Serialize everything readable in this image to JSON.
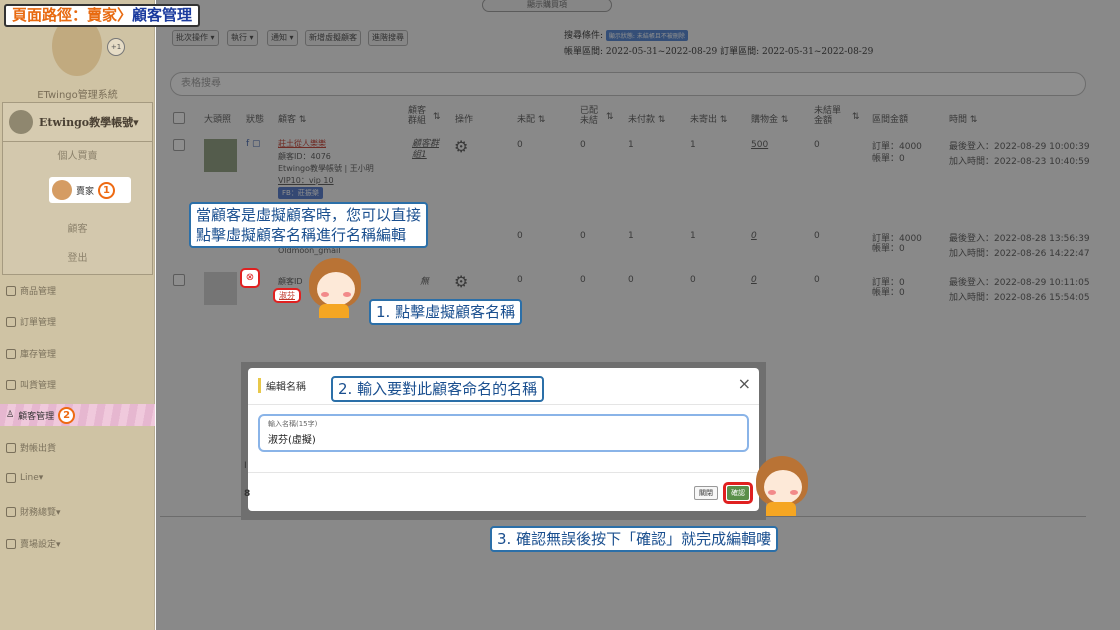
{
  "breadcrumb": {
    "prefix": "頁面路徑：賣家",
    "separator": "〉",
    "current": "顧客管理"
  },
  "sidebar": {
    "system_name": "ETwingo管理系統",
    "badge": "+1",
    "account": "Etwingo教學帳號▾",
    "menu": {
      "personal": "個人買賣",
      "seller": "賣家",
      "seller_step": "1",
      "customer": "顧客",
      "logout": "登出"
    },
    "items": [
      {
        "label": "商品管理"
      },
      {
        "label": "訂單管理"
      },
      {
        "label": "庫存管理"
      },
      {
        "label": "叫貨管理"
      },
      {
        "label": "顧客管理",
        "step": "2"
      },
      {
        "label": "對帳出貨"
      },
      {
        "label": "Line▾"
      },
      {
        "label": "財務總覽▾"
      },
      {
        "label": "賣場設定▾"
      }
    ]
  },
  "toolbar": {
    "top_select": "顯示購買項",
    "buttons": [
      "批次操作 ▾",
      "執行 ▾",
      "通知 ▾",
      "新增虛擬顧客",
      "進階搜尋"
    ],
    "filter_label": "搜尋條件:",
    "filter_tag": "顯示狀態: 未結帳且不被刪除",
    "range": "帳單區間: 2022-05-31~2022-08-29   訂單區間: 2022-05-31~2022-08-29"
  },
  "search": {
    "placeholder": "表格搜尋"
  },
  "table": {
    "headers": [
      "大頭照",
      "狀態",
      "顧客 ⇅",
      "顧客 群組",
      "⇅",
      "操作",
      "未配 ⇅",
      "已配 未結",
      "⇅",
      "未付款 ⇅",
      "未寄出 ⇅",
      "購物金 ⇅",
      "未結單 金額",
      "⇅",
      "區間金額",
      "時間 ⇅"
    ],
    "rows": [
      {
        "name": "莊土從人樂樂",
        "id": "顧客ID：4076",
        "group_owner": "Etwingo教學帳號 | 王小明",
        "vip": "VIP10：vip 10",
        "fb": "FB：莊振樂",
        "group": "顧客群組1",
        "unassigned": "0",
        "unsettled": "0",
        "unpaid": "1",
        "unsent": "1",
        "credit": "500",
        "balance": "0",
        "orders": "訂單：4000",
        "bills": "帳單：0",
        "last_login": "最後登入：2022-08-29 10:00:39",
        "joined": "加入時間：2022-08-23 10:40:59"
      },
      {
        "name": "Oldmoon_gmail",
        "unassigned": "0",
        "unsettled": "0",
        "unpaid": "1",
        "unsent": "1",
        "credit": "0",
        "balance": "0",
        "orders": "訂單：4000",
        "bills": "帳單：0",
        "last_login": "最後登入：2022-08-28 13:56:39",
        "joined": "加入時間：2022-08-26 14:22:47"
      },
      {
        "id": "顧客ID",
        "name": "淑芬",
        "group": "無",
        "unassigned": "0",
        "unsettled": "0",
        "unpaid": "0",
        "unsent": "0",
        "credit": "0",
        "balance": "0",
        "orders": "訂單：0",
        "bills": "帳單：0",
        "last_login": "最後登入：2022-08-29 10:11:05",
        "joined": "加入時間：2022-08-26 15:54:05"
      }
    ]
  },
  "callouts": {
    "hint": "當顧客是虛擬顧客時，您可以直接\n點擊虛擬顧客名稱進行名稱編輯",
    "step1": "1. 點擊虛擬顧客名稱",
    "step2": "2. 輸入要對此顧客命名的名稱",
    "step3": "3. 確認無誤後按下「確認」就完成編輯嘍"
  },
  "modal": {
    "title": "編輯名稱",
    "close": "×",
    "field_label": "輸入名稱(15字)",
    "field_value": "淑芬(虛擬)",
    "cancel": "關閉",
    "confirm": "確認"
  },
  "colors": {
    "orange": "#ee6a12",
    "blue": "#1a3a9e",
    "callout_border": "#2b6fa8",
    "highlight": "#e02020"
  }
}
